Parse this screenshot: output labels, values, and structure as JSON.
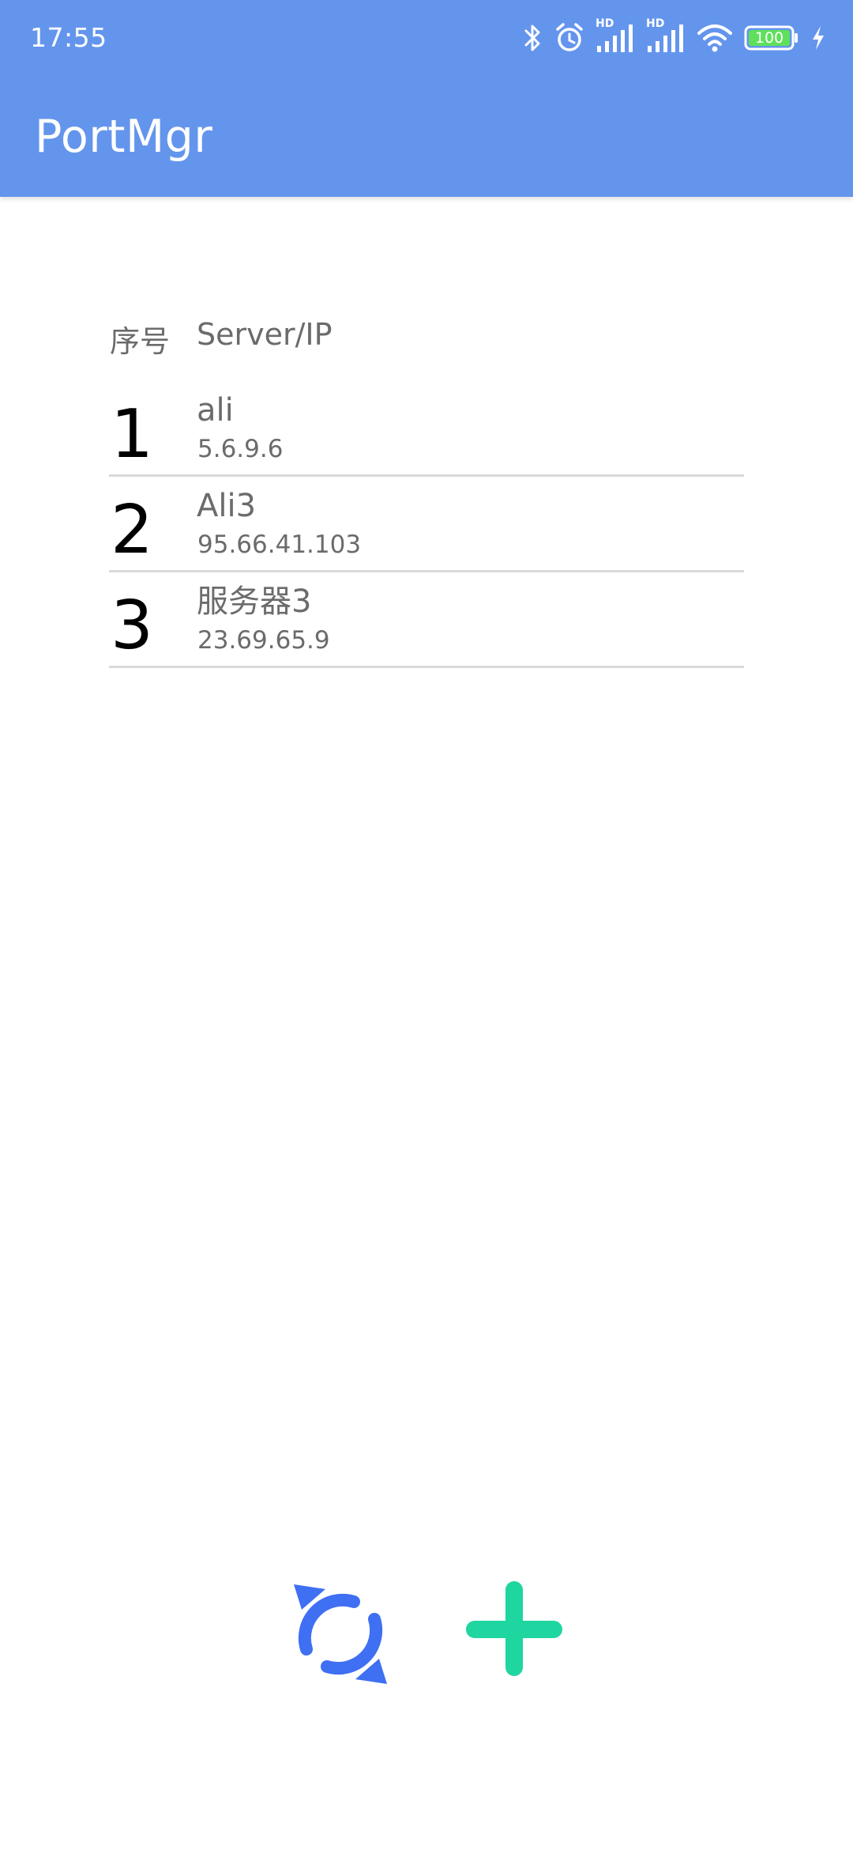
{
  "status_bar": {
    "time": "17:55",
    "battery_level": "100",
    "network_label_1": "HD",
    "network_label_2": "HD",
    "icons": [
      "bluetooth-icon",
      "alarm-icon",
      "signal-icon",
      "signal-icon",
      "wifi-icon",
      "battery-icon",
      "charging-icon"
    ]
  },
  "appbar": {
    "title": "PortMgr",
    "color": "#6495ed"
  },
  "list": {
    "header": {
      "index_label": "序号",
      "server_label": "Server/IP"
    },
    "rows": [
      {
        "index": "1",
        "name": "ali",
        "ip": "5.6.9.6"
      },
      {
        "index": "2",
        "name": "Ali3",
        "ip": "95.66.41.103"
      },
      {
        "index": "3",
        "name": "服务器3",
        "ip": "23.69.65.9"
      }
    ]
  },
  "actions": {
    "refresh_icon": "refresh-icon",
    "refresh_color": "#3f6ff2",
    "add_icon": "plus-icon",
    "add_color": "#1fd6a0"
  }
}
